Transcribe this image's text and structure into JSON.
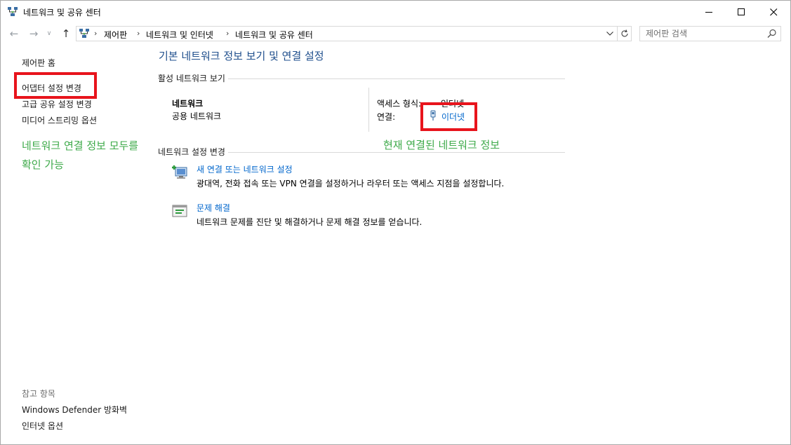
{
  "window": {
    "title": "네트워크 및 공유 센터"
  },
  "titlebar_buttons": {
    "minimize": "—",
    "maximize": "☐",
    "close": "✕"
  },
  "nav": {
    "back": "←",
    "forward": "→",
    "recent": "∨",
    "up": "↑"
  },
  "address": {
    "separator": "›",
    "crumbs": [
      "제어판",
      "네트워크 및 인터넷",
      "네트워크 및 공유 센터"
    ]
  },
  "search": {
    "placeholder": "제어판 검색"
  },
  "sidebar": {
    "items": [
      "제어판 홈",
      "어댑터 설정 변경",
      "고급 공유 설정 변경",
      "미디어 스트리밍 옵션"
    ],
    "see_also_header": "참고 항목",
    "see_also": [
      "Windows Defender 방화벽",
      "인터넷 옵션"
    ]
  },
  "annotations": {
    "left_line1": "네트워크 연결 정보 모두를",
    "left_line2": "확인 가능",
    "right": "현재 연결된 네트워크 정보"
  },
  "main": {
    "title": "기본 네트워크 정보 보기 및 연결 설정",
    "active_section": "활성 네트워크 보기",
    "network_name": "네트워크",
    "network_type": "공용 네트워크",
    "access_type_label": "액세스 형식:",
    "access_type_value": "인터넷",
    "connection_label": "연결:",
    "connection_value": "이더넷",
    "change_section": "네트워크 설정 변경",
    "tasks": [
      {
        "title": "새 연결 또는 네트워크 설정",
        "desc": "광대역, 전화 접속 또는 VPN 연결을 설정하거나 라우터 또는 액세스 지점을 설정합니다."
      },
      {
        "title": "문제 해결",
        "desc": "네트워크 문제를 진단 및 해결하거나 문제 해결 정보를 얻습니다."
      }
    ]
  },
  "colors": {
    "link": "#0066cc",
    "title": "#1e4e8c",
    "highlight_box": "#e8141c",
    "annotation": "#3eaa4a"
  }
}
